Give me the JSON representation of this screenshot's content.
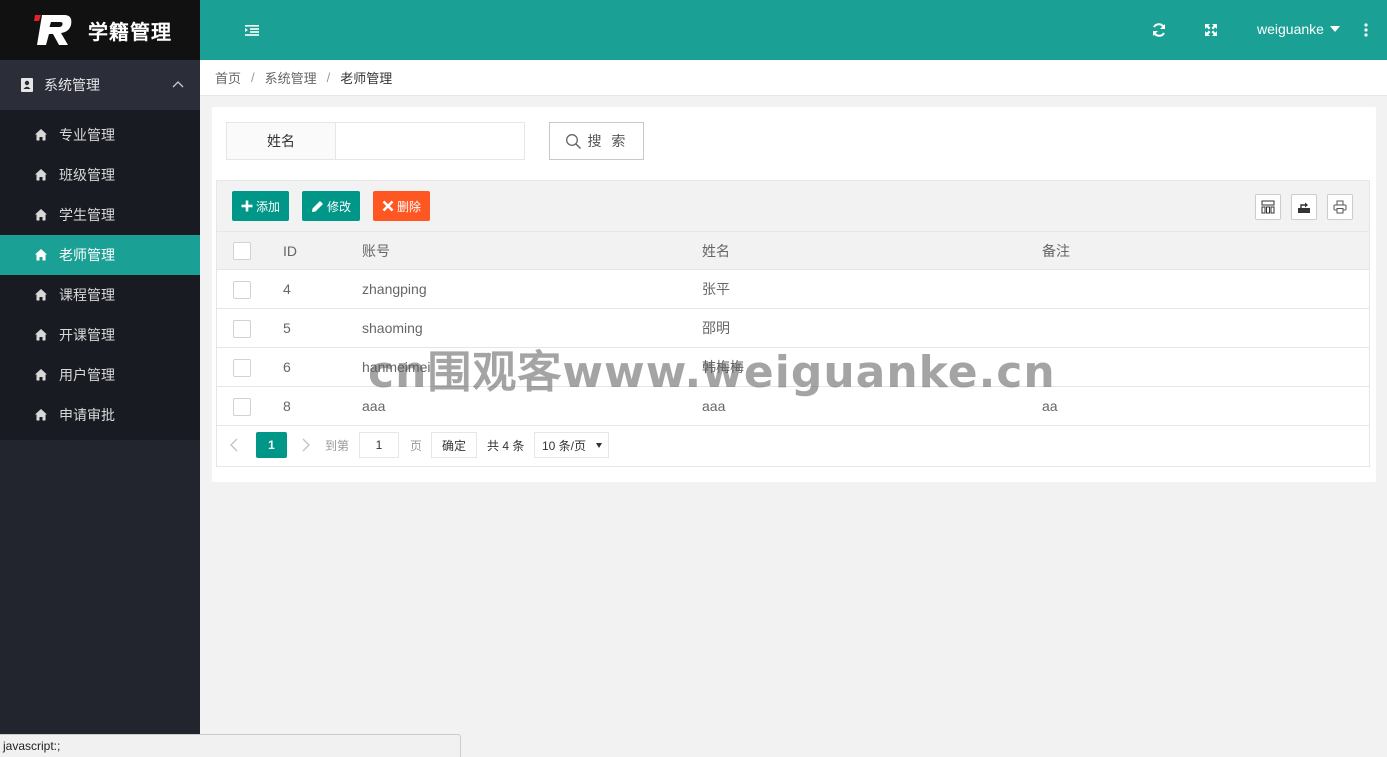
{
  "app": {
    "title": "学籍管理"
  },
  "sidebar": {
    "group_label": "系统管理",
    "items": [
      {
        "label": "专业管理",
        "active": false
      },
      {
        "label": "班级管理",
        "active": false
      },
      {
        "label": "学生管理",
        "active": false
      },
      {
        "label": "老师管理",
        "active": true
      },
      {
        "label": "课程管理",
        "active": false
      },
      {
        "label": "开课管理",
        "active": false
      },
      {
        "label": "用户管理",
        "active": false
      },
      {
        "label": "申请审批",
        "active": false
      }
    ]
  },
  "header": {
    "username": "weiguanke"
  },
  "breadcrumb": [
    "首页",
    "系统管理",
    "老师管理"
  ],
  "search": {
    "field_label": "姓名",
    "value": "",
    "button_label": "搜 索"
  },
  "toolbar": {
    "add_label": "添加",
    "edit_label": "修改",
    "delete_label": "删除"
  },
  "table": {
    "columns": [
      "ID",
      "账号",
      "姓名",
      "备注"
    ],
    "rows": [
      {
        "id": "4",
        "account": "zhangping",
        "name": "张平",
        "note": ""
      },
      {
        "id": "5",
        "account": "shaoming",
        "name": "邵明",
        "note": ""
      },
      {
        "id": "6",
        "account": "hanmeimei",
        "name": "韩梅梅",
        "note": ""
      },
      {
        "id": "8",
        "account": "aaa",
        "name": "aaa",
        "note": "aa"
      }
    ]
  },
  "pager": {
    "current_page": "1",
    "goto_label": "到第",
    "goto_value": "1",
    "page_label": "页",
    "confirm_label": "确定",
    "total_label": "共 4 条",
    "page_size": "10 条/页"
  },
  "watermark": "cn围观客www.weiguanke.cn",
  "statusbar": "javascript:;",
  "colors": {
    "accent": "#1aa094",
    "primary_button": "#009688",
    "danger_button": "#ff5722",
    "sidebar_bg": "#22252e"
  }
}
